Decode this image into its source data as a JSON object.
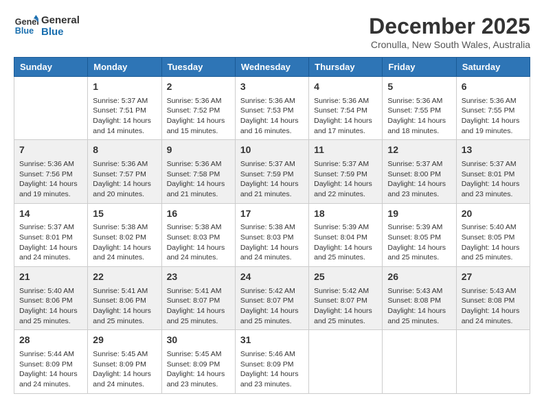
{
  "logo": {
    "text_general": "General",
    "text_blue": "Blue"
  },
  "title": "December 2025",
  "subtitle": "Cronulla, New South Wales, Australia",
  "days_of_week": [
    "Sunday",
    "Monday",
    "Tuesday",
    "Wednesday",
    "Thursday",
    "Friday",
    "Saturday"
  ],
  "weeks": [
    [
      {
        "day": "",
        "info": ""
      },
      {
        "day": "1",
        "info": "Sunrise: 5:37 AM\nSunset: 7:51 PM\nDaylight: 14 hours\nand 14 minutes."
      },
      {
        "day": "2",
        "info": "Sunrise: 5:36 AM\nSunset: 7:52 PM\nDaylight: 14 hours\nand 15 minutes."
      },
      {
        "day": "3",
        "info": "Sunrise: 5:36 AM\nSunset: 7:53 PM\nDaylight: 14 hours\nand 16 minutes."
      },
      {
        "day": "4",
        "info": "Sunrise: 5:36 AM\nSunset: 7:54 PM\nDaylight: 14 hours\nand 17 minutes."
      },
      {
        "day": "5",
        "info": "Sunrise: 5:36 AM\nSunset: 7:55 PM\nDaylight: 14 hours\nand 18 minutes."
      },
      {
        "day": "6",
        "info": "Sunrise: 5:36 AM\nSunset: 7:55 PM\nDaylight: 14 hours\nand 19 minutes."
      }
    ],
    [
      {
        "day": "7",
        "info": "Sunrise: 5:36 AM\nSunset: 7:56 PM\nDaylight: 14 hours\nand 19 minutes."
      },
      {
        "day": "8",
        "info": "Sunrise: 5:36 AM\nSunset: 7:57 PM\nDaylight: 14 hours\nand 20 minutes."
      },
      {
        "day": "9",
        "info": "Sunrise: 5:36 AM\nSunset: 7:58 PM\nDaylight: 14 hours\nand 21 minutes."
      },
      {
        "day": "10",
        "info": "Sunrise: 5:37 AM\nSunset: 7:59 PM\nDaylight: 14 hours\nand 21 minutes."
      },
      {
        "day": "11",
        "info": "Sunrise: 5:37 AM\nSunset: 7:59 PM\nDaylight: 14 hours\nand 22 minutes."
      },
      {
        "day": "12",
        "info": "Sunrise: 5:37 AM\nSunset: 8:00 PM\nDaylight: 14 hours\nand 23 minutes."
      },
      {
        "day": "13",
        "info": "Sunrise: 5:37 AM\nSunset: 8:01 PM\nDaylight: 14 hours\nand 23 minutes."
      }
    ],
    [
      {
        "day": "14",
        "info": "Sunrise: 5:37 AM\nSunset: 8:01 PM\nDaylight: 14 hours\nand 24 minutes."
      },
      {
        "day": "15",
        "info": "Sunrise: 5:38 AM\nSunset: 8:02 PM\nDaylight: 14 hours\nand 24 minutes."
      },
      {
        "day": "16",
        "info": "Sunrise: 5:38 AM\nSunset: 8:03 PM\nDaylight: 14 hours\nand 24 minutes."
      },
      {
        "day": "17",
        "info": "Sunrise: 5:38 AM\nSunset: 8:03 PM\nDaylight: 14 hours\nand 24 minutes."
      },
      {
        "day": "18",
        "info": "Sunrise: 5:39 AM\nSunset: 8:04 PM\nDaylight: 14 hours\nand 25 minutes."
      },
      {
        "day": "19",
        "info": "Sunrise: 5:39 AM\nSunset: 8:05 PM\nDaylight: 14 hours\nand 25 minutes."
      },
      {
        "day": "20",
        "info": "Sunrise: 5:40 AM\nSunset: 8:05 PM\nDaylight: 14 hours\nand 25 minutes."
      }
    ],
    [
      {
        "day": "21",
        "info": "Sunrise: 5:40 AM\nSunset: 8:06 PM\nDaylight: 14 hours\nand 25 minutes."
      },
      {
        "day": "22",
        "info": "Sunrise: 5:41 AM\nSunset: 8:06 PM\nDaylight: 14 hours\nand 25 minutes."
      },
      {
        "day": "23",
        "info": "Sunrise: 5:41 AM\nSunset: 8:07 PM\nDaylight: 14 hours\nand 25 minutes."
      },
      {
        "day": "24",
        "info": "Sunrise: 5:42 AM\nSunset: 8:07 PM\nDaylight: 14 hours\nand 25 minutes."
      },
      {
        "day": "25",
        "info": "Sunrise: 5:42 AM\nSunset: 8:07 PM\nDaylight: 14 hours\nand 25 minutes."
      },
      {
        "day": "26",
        "info": "Sunrise: 5:43 AM\nSunset: 8:08 PM\nDaylight: 14 hours\nand 25 minutes."
      },
      {
        "day": "27",
        "info": "Sunrise: 5:43 AM\nSunset: 8:08 PM\nDaylight: 14 hours\nand 24 minutes."
      }
    ],
    [
      {
        "day": "28",
        "info": "Sunrise: 5:44 AM\nSunset: 8:09 PM\nDaylight: 14 hours\nand 24 minutes."
      },
      {
        "day": "29",
        "info": "Sunrise: 5:45 AM\nSunset: 8:09 PM\nDaylight: 14 hours\nand 24 minutes."
      },
      {
        "day": "30",
        "info": "Sunrise: 5:45 AM\nSunset: 8:09 PM\nDaylight: 14 hours\nand 23 minutes."
      },
      {
        "day": "31",
        "info": "Sunrise: 5:46 AM\nSunset: 8:09 PM\nDaylight: 14 hours\nand 23 minutes."
      },
      {
        "day": "",
        "info": ""
      },
      {
        "day": "",
        "info": ""
      },
      {
        "day": "",
        "info": ""
      }
    ]
  ]
}
